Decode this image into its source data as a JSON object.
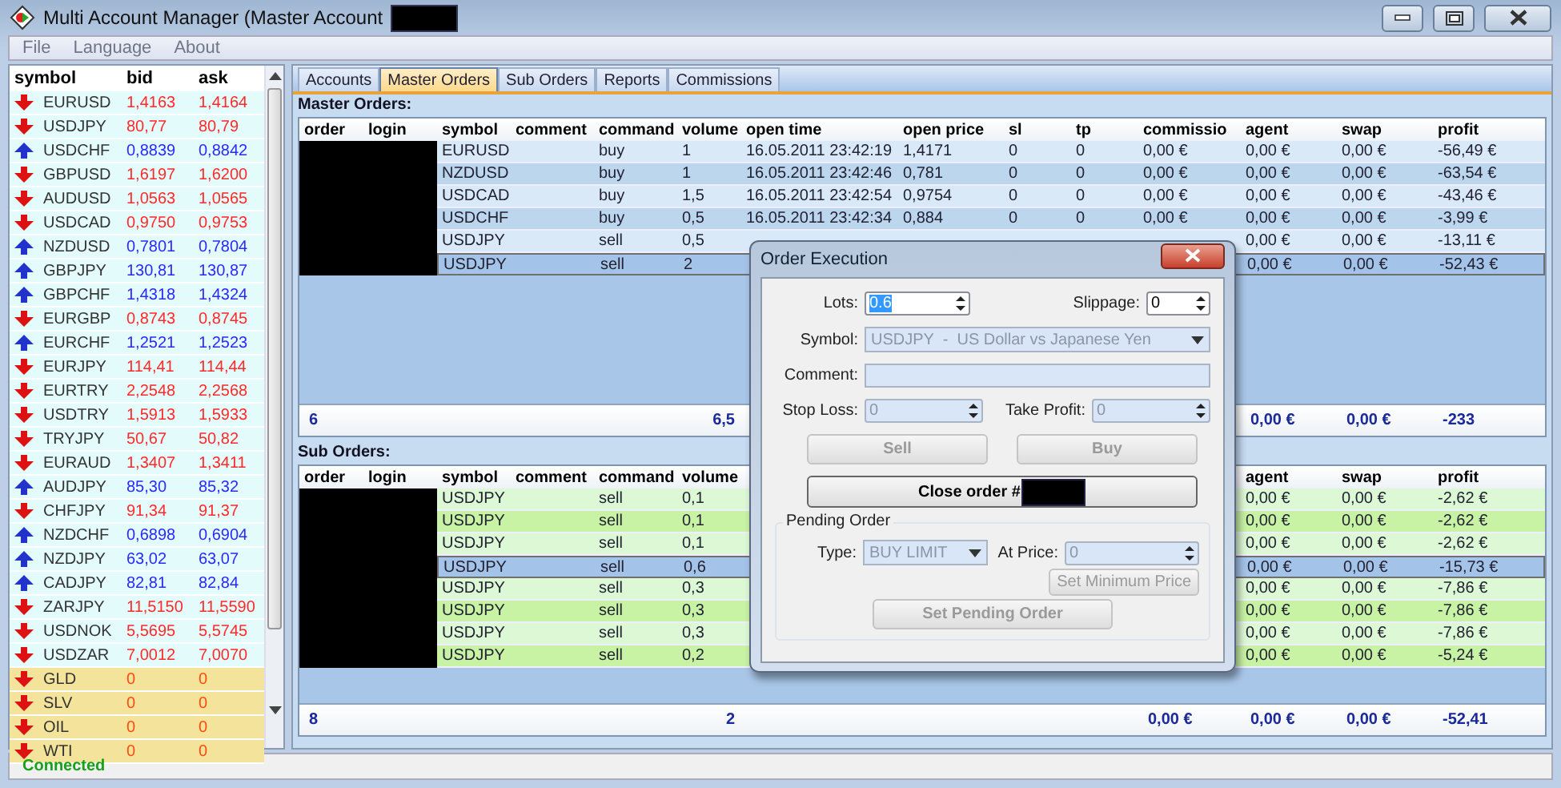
{
  "window": {
    "title": "Multi Account Manager (Master Account"
  },
  "menu": [
    "File",
    "Language",
    "About"
  ],
  "quotes": {
    "columns": [
      "symbol",
      "bid",
      "ask"
    ],
    "rows": [
      {
        "symbol": "EURUSD",
        "bid": "1,4163",
        "ask": "1,4164",
        "rising": false,
        "kind": "currency"
      },
      {
        "symbol": "USDJPY",
        "bid": "80,77",
        "ask": "80,79",
        "rising": false,
        "kind": "currency"
      },
      {
        "symbol": "USDCHF",
        "bid": "0,8839",
        "ask": "0,8842",
        "rising": true,
        "kind": "currency"
      },
      {
        "symbol": "GBPUSD",
        "bid": "1,6197",
        "ask": "1,6200",
        "rising": false,
        "kind": "currency"
      },
      {
        "symbol": "AUDUSD",
        "bid": "1,0563",
        "ask": "1,0565",
        "rising": false,
        "kind": "currency"
      },
      {
        "symbol": "USDCAD",
        "bid": "0,9750",
        "ask": "0,9753",
        "rising": false,
        "kind": "currency"
      },
      {
        "symbol": "NZDUSD",
        "bid": "0,7801",
        "ask": "0,7804",
        "rising": true,
        "kind": "currency"
      },
      {
        "symbol": "GBPJPY",
        "bid": "130,81",
        "ask": "130,87",
        "rising": true,
        "kind": "currency"
      },
      {
        "symbol": "GBPCHF",
        "bid": "1,4318",
        "ask": "1,4324",
        "rising": true,
        "kind": "currency"
      },
      {
        "symbol": "EURGBP",
        "bid": "0,8743",
        "ask": "0,8745",
        "rising": false,
        "kind": "currency"
      },
      {
        "symbol": "EURCHF",
        "bid": "1,2521",
        "ask": "1,2523",
        "rising": true,
        "kind": "currency"
      },
      {
        "symbol": "EURJPY",
        "bid": "114,41",
        "ask": "114,44",
        "rising": false,
        "kind": "currency"
      },
      {
        "symbol": "EURTRY",
        "bid": "2,2548",
        "ask": "2,2568",
        "rising": false,
        "kind": "currency"
      },
      {
        "symbol": "USDTRY",
        "bid": "1,5913",
        "ask": "1,5933",
        "rising": false,
        "kind": "currency"
      },
      {
        "symbol": "TRYJPY",
        "bid": "50,67",
        "ask": "50,82",
        "rising": false,
        "kind": "currency"
      },
      {
        "symbol": "EURAUD",
        "bid": "1,3407",
        "ask": "1,3411",
        "rising": false,
        "kind": "currency"
      },
      {
        "symbol": "AUDJPY",
        "bid": "85,30",
        "ask": "85,32",
        "rising": true,
        "kind": "currency"
      },
      {
        "symbol": "CHFJPY",
        "bid": "91,34",
        "ask": "91,37",
        "rising": false,
        "kind": "currency"
      },
      {
        "symbol": "NZDCHF",
        "bid": "0,6898",
        "ask": "0,6904",
        "rising": true,
        "kind": "currency"
      },
      {
        "symbol": "NZDJPY",
        "bid": "63,02",
        "ask": "63,07",
        "rising": true,
        "kind": "currency"
      },
      {
        "symbol": "CADJPY",
        "bid": "82,81",
        "ask": "82,84",
        "rising": true,
        "kind": "currency"
      },
      {
        "symbol": "ZARJPY",
        "bid": "11,5150",
        "ask": "11,5590",
        "rising": false,
        "kind": "currency"
      },
      {
        "symbol": "USDNOK",
        "bid": "5,5695",
        "ask": "5,5745",
        "rising": false,
        "kind": "currency"
      },
      {
        "symbol": "USDZAR",
        "bid": "7,0012",
        "ask": "7,0070",
        "rising": false,
        "kind": "currency"
      },
      {
        "symbol": "GLD",
        "bid": "0",
        "ask": "0",
        "rising": false,
        "kind": "commodity"
      },
      {
        "symbol": "SLV",
        "bid": "0",
        "ask": "0",
        "rising": false,
        "kind": "commodity"
      },
      {
        "symbol": "OIL",
        "bid": "0",
        "ask": "0",
        "rising": false,
        "kind": "commodity"
      },
      {
        "symbol": "WTI",
        "bid": "0",
        "ask": "0",
        "rising": false,
        "kind": "commodity"
      }
    ]
  },
  "tabs": [
    {
      "label": "Accounts",
      "selected": false
    },
    {
      "label": "Master Orders",
      "selected": true
    },
    {
      "label": "Sub Orders",
      "selected": false
    },
    {
      "label": "Reports",
      "selected": false
    },
    {
      "label": "Commissions",
      "selected": false
    }
  ],
  "master_orders": {
    "title": "Master Orders:",
    "headers": {
      "order": "order",
      "login": "login",
      "symbol": "symbol",
      "comment": "comment",
      "command": "command",
      "volume": "volume",
      "open_time": "open time",
      "open_price": "open price",
      "sl": "sl",
      "tp": "tp",
      "commission": "commissio",
      "agent": "agent",
      "swap": "swap",
      "profit": "profit"
    },
    "rows": [
      {
        "symbol": "EURUSD",
        "command": "buy",
        "volume": "1",
        "open_time": "16.05.2011 23:42:19",
        "open_price": "1,4171",
        "sl": "0",
        "tp": "0",
        "commission": "0,00 €",
        "agent": "0,00 €",
        "swap": "0,00 €",
        "profit": "-56,49 €",
        "selected": false
      },
      {
        "symbol": "NZDUSD",
        "command": "buy",
        "volume": "1",
        "open_time": "16.05.2011 23:42:46",
        "open_price": "0,781",
        "sl": "0",
        "tp": "0",
        "commission": "0,00 €",
        "agent": "0,00 €",
        "swap": "0,00 €",
        "profit": "-63,54 €",
        "selected": false
      },
      {
        "symbol": "USDCAD",
        "command": "buy",
        "volume": "1,5",
        "open_time": "16.05.2011 23:42:54",
        "open_price": "0,9754",
        "sl": "0",
        "tp": "0",
        "commission": "0,00 €",
        "agent": "0,00 €",
        "swap": "0,00 €",
        "profit": "-43,46 €",
        "selected": false
      },
      {
        "symbol": "USDCHF",
        "command": "buy",
        "volume": "0,5",
        "open_time": "16.05.2011 23:42:34",
        "open_price": "0,884",
        "sl": "0",
        "tp": "0",
        "commission": "0,00 €",
        "agent": "0,00 €",
        "swap": "0,00 €",
        "profit": "-3,99 €",
        "selected": false
      },
      {
        "symbol": "USDJPY",
        "command": "sell",
        "volume": "0,5",
        "agent": "0,00 €",
        "swap": "0,00 €",
        "profit": "-13,11 €",
        "selected": false
      },
      {
        "symbol": "USDJPY",
        "command": "sell",
        "volume": "2",
        "agent": "0,00 €",
        "swap": "0,00 €",
        "profit": "-52,43 €",
        "selected": true
      }
    ],
    "summary": {
      "order": "6",
      "volume": "6,5",
      "agent": "0,00 €",
      "swap": "0,00 €",
      "profit": "-233"
    }
  },
  "sub_orders": {
    "title": "Sub Orders:",
    "headers": {
      "order": "order",
      "login": "login",
      "symbol": "symbol",
      "comment": "comment",
      "command": "command",
      "volume": "volume",
      "agent": "agent",
      "swap": "swap",
      "profit": "profit"
    },
    "rows": [
      {
        "symbol": "USDJPY",
        "command": "sell",
        "volume": "0,1",
        "agent": "0,00 €",
        "swap": "0,00 €",
        "profit": "-2,62 €",
        "selected": false
      },
      {
        "symbol": "USDJPY",
        "command": "sell",
        "volume": "0,1",
        "agent": "0,00 €",
        "swap": "0,00 €",
        "profit": "-2,62 €",
        "selected": false
      },
      {
        "symbol": "USDJPY",
        "command": "sell",
        "volume": "0,1",
        "agent": "0,00 €",
        "swap": "0,00 €",
        "profit": "-2,62 €",
        "selected": false
      },
      {
        "symbol": "USDJPY",
        "command": "sell",
        "volume": "0,6",
        "agent": "0,00 €",
        "swap": "0,00 €",
        "profit": "-15,73 €",
        "selected": true
      },
      {
        "symbol": "USDJPY",
        "command": "sell",
        "volume": "0,3",
        "agent": "0,00 €",
        "swap": "0,00 €",
        "profit": "-7,86 €",
        "selected": false
      },
      {
        "symbol": "USDJPY",
        "command": "sell",
        "volume": "0,3",
        "agent": "0,00 €",
        "swap": "0,00 €",
        "profit": "-7,86 €",
        "selected": false
      },
      {
        "symbol": "USDJPY",
        "command": "sell",
        "volume": "0,3",
        "agent": "0,00 €",
        "swap": "0,00 €",
        "profit": "-7,86 €",
        "selected": false
      },
      {
        "symbol": "USDJPY",
        "command": "sell",
        "volume": "0,2",
        "agent": "0,00 €",
        "swap": "0,00 €",
        "profit": "-5,24 €",
        "selected": false
      }
    ],
    "summary": {
      "order": "8",
      "volume": "2",
      "commission": "0,00 €",
      "agent": "0,00 €",
      "swap": "0,00 €",
      "profit": "-52,41"
    }
  },
  "dialog": {
    "title": "Order Execution",
    "lots": {
      "label": "Lots:",
      "value": "0.6",
      "text_selected": true,
      "disabled": false
    },
    "slippage": {
      "label": "Slippage:",
      "value": "0",
      "disabled": false
    },
    "symbol": {
      "label": "Symbol:",
      "value": "USDJPY  -  US Dollar vs Japanese Yen",
      "disabled": true
    },
    "comment": {
      "label": "Comment:",
      "disabled": true
    },
    "stop_loss": {
      "label": "Stop Loss:",
      "value": "0",
      "disabled": true
    },
    "take_profit": {
      "label": "Take Profit:",
      "value": "0",
      "disabled": true
    },
    "sell_button": {
      "label": "Sell",
      "disabled": true
    },
    "buy_button": {
      "label": "Buy",
      "disabled": true
    },
    "close_order_button": {
      "label": "Close order #",
      "disabled": false
    },
    "pending_order": {
      "title": "Pending Order",
      "type": {
        "label": "Type:",
        "value": "BUY LIMIT",
        "disabled": true
      },
      "at_price": {
        "label": "At Price:",
        "value": "0",
        "disabled": true
      },
      "set_minimum_price_button": {
        "label": "Set Minimum Price",
        "disabled": true
      },
      "set_pending_order_button": {
        "label": "Set Pending Order",
        "disabled": true
      }
    }
  },
  "status_bar": {
    "text": "Connected"
  }
}
